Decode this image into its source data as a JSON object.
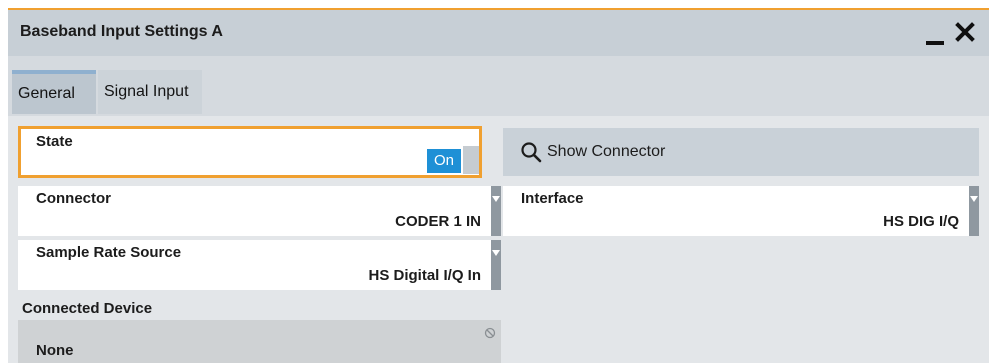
{
  "window": {
    "title": "Baseband Input Settings  A"
  },
  "tabs": [
    {
      "label": "General",
      "active": true
    },
    {
      "label": "Signal Input",
      "active": false
    }
  ],
  "state": {
    "label": "State",
    "value": "On"
  },
  "show_connector": {
    "label": "Show Connector",
    "icon": "search-icon"
  },
  "connector": {
    "label": "Connector",
    "value": "CODER 1 IN"
  },
  "interface": {
    "label": "Interface",
    "value": "HS DIG I/Q"
  },
  "sample_rate_source": {
    "label": "Sample Rate Source",
    "value": "HS Digital I/Q In"
  },
  "connected_device": {
    "label": "Connected Device",
    "value": "None"
  },
  "colors": {
    "focus_border": "#f0a030",
    "toggle_on": "#1e90d6",
    "titlebar": "#c7cfd6",
    "dropdown_strip": "#8f98a0"
  }
}
